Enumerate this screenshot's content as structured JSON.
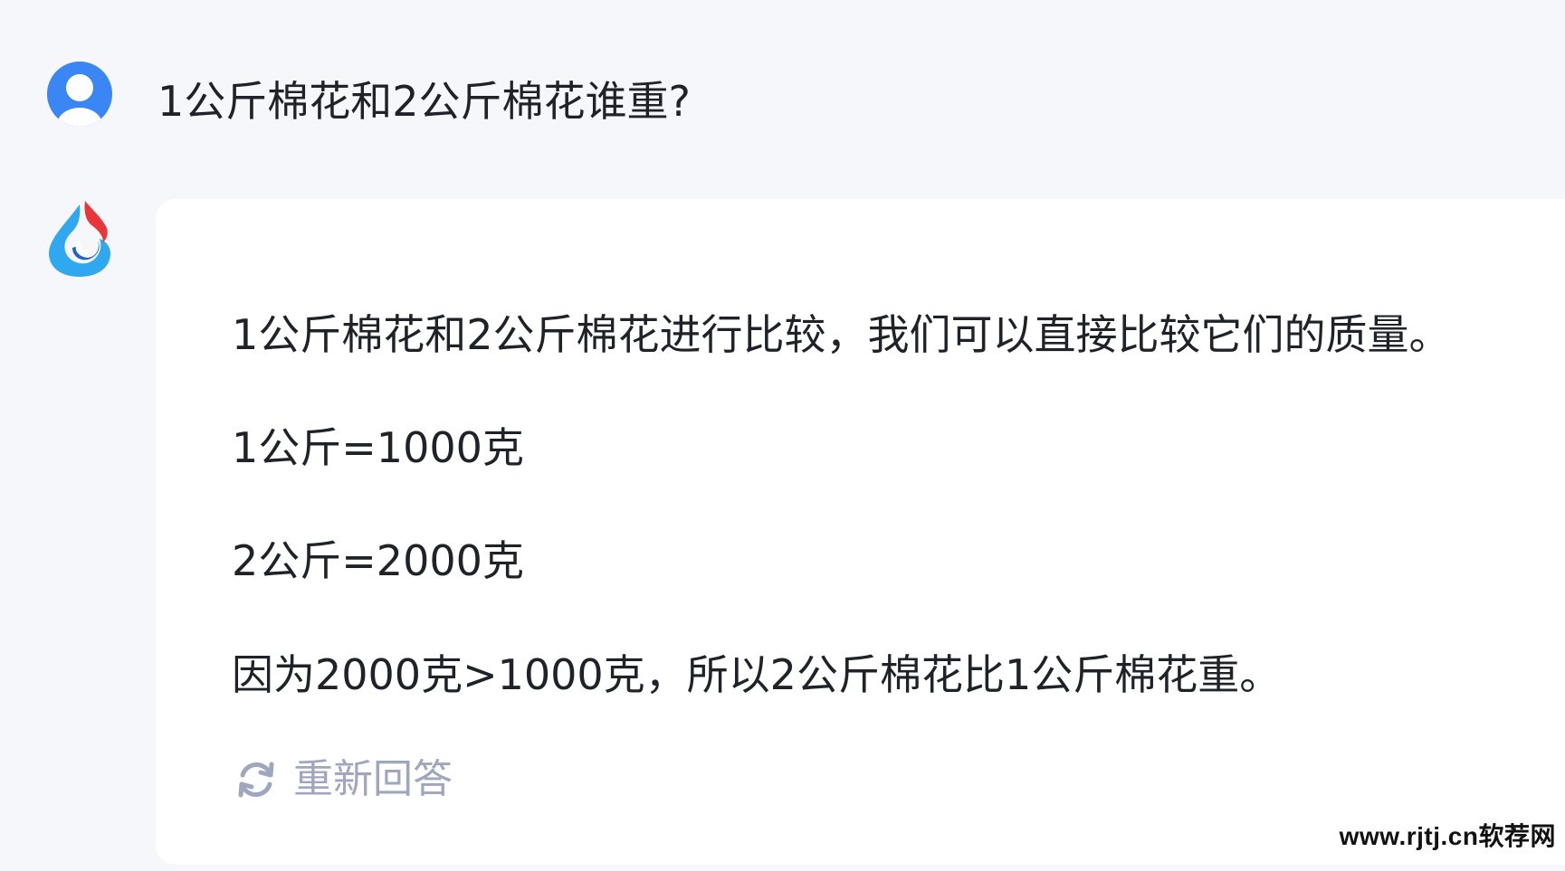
{
  "conversation": {
    "user_question": "1公斤棉花和2公斤棉花谁重?",
    "answer_lines": [
      "1公斤棉花和2公斤棉花进行比较，我们可以直接比较它们的质量。",
      "1公斤=1000克",
      "2公斤=2000克",
      "因为2000克>1000克，所以2公斤棉花比1公斤棉花重。"
    ],
    "regenerate_label": "重新回答"
  },
  "watermark": "www.rjtj.cn软荐网",
  "icons": {
    "user_avatar": "user-avatar-icon",
    "bot_avatar": "bot-logo-icon",
    "regenerate": "refresh-icon"
  },
  "colors": {
    "user_avatar_blue": "#3a86f5",
    "bot_blue": "#2fa8ef",
    "bot_red": "#e8373b",
    "regen_gray": "#9ea7bd",
    "card_bg": "#ffffff",
    "page_bg": "#f5f7fa"
  }
}
